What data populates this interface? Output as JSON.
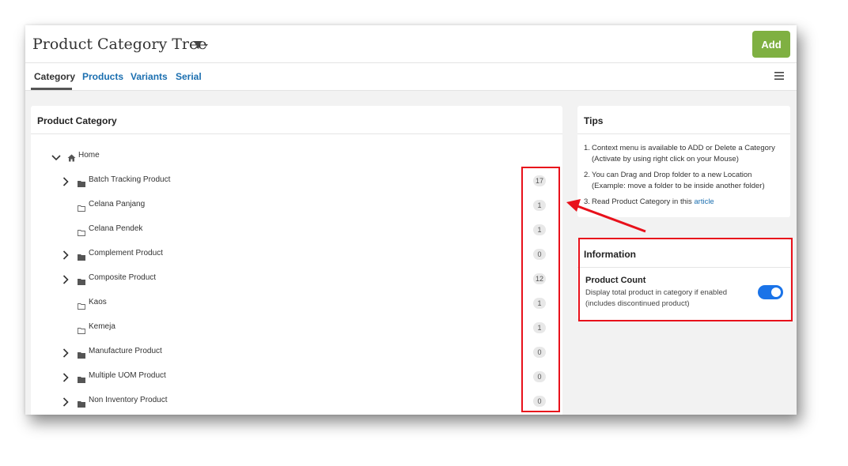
{
  "header": {
    "title": "Product Category Tree",
    "add_label": "Add",
    "filter_icon": "filter-dropdown-icon",
    "accent_color": "#7fb042"
  },
  "tabs": [
    {
      "label": "Category",
      "active": true
    },
    {
      "label": "Products",
      "active": false
    },
    {
      "label": "Variants",
      "active": false
    },
    {
      "label": "Serial",
      "active": false
    }
  ],
  "category_panel": {
    "title": "Product Category",
    "root": {
      "label": "Home",
      "icon": "home-icon",
      "expanded": true
    },
    "items": [
      {
        "label": "Batch Tracking Product",
        "count": "17",
        "has_children": true
      },
      {
        "label": "Celana Panjang",
        "count": "1",
        "has_children": false
      },
      {
        "label": "Celana Pendek",
        "count": "1",
        "has_children": false
      },
      {
        "label": "Complement Product",
        "count": "0",
        "has_children": true
      },
      {
        "label": "Composite Product",
        "count": "12",
        "has_children": true
      },
      {
        "label": "Kaos",
        "count": "1",
        "has_children": false
      },
      {
        "label": "Kemeja",
        "count": "1",
        "has_children": false
      },
      {
        "label": "Manufacture Product",
        "count": "0",
        "has_children": true
      },
      {
        "label": "Multiple UOM Product",
        "count": "0",
        "has_children": true
      },
      {
        "label": "Non Inventory Product",
        "count": "0",
        "has_children": true
      }
    ]
  },
  "tips": {
    "title": "Tips",
    "items": [
      {
        "num": "1.",
        "text": "Context menu is available to ADD or Delete a Category (Activate by using right click on your Mouse)"
      },
      {
        "num": "2.",
        "text": "You can Drag and Drop folder to a new Location (Example: move a folder to be inside another folder)"
      },
      {
        "num": "3.",
        "text": "Read Product Category in this ",
        "link": "article"
      }
    ]
  },
  "information": {
    "title": "Information",
    "product_count_label": "Product Count",
    "product_count_desc": "Display total product in category if enabled (includes discontinued product)",
    "product_count_enabled": true,
    "toggle_color": "#1a73e8"
  },
  "annotation_color": "#e8111b"
}
